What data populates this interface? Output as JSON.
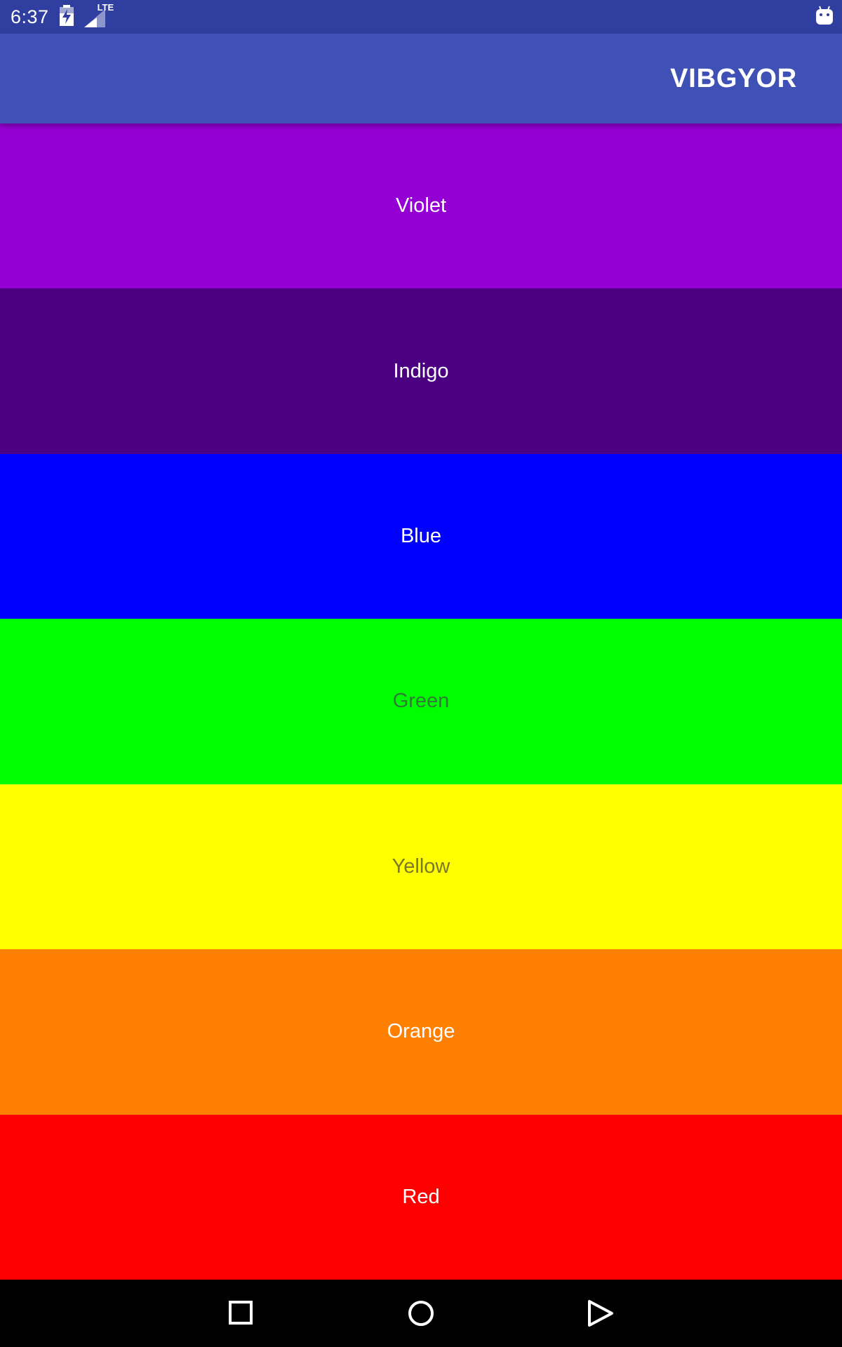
{
  "status_bar": {
    "time": "6:37",
    "icons": [
      "battery-charging-icon",
      "signal-lte-icon",
      "android-debug-icon"
    ],
    "network_label": "LTE"
  },
  "app_bar": {
    "action_label": "VIBGYOR",
    "color": "#3F51B5"
  },
  "colors": [
    {
      "label": "Violet",
      "background": "#9400D3",
      "text_color": "#FFFFFF"
    },
    {
      "label": "Indigo",
      "background": "#4B0082",
      "text_color": "#FFFFFF"
    },
    {
      "label": "Blue",
      "background": "#0000FF",
      "text_color": "#FFFFFF"
    },
    {
      "label": "Green",
      "background": "#00FF00",
      "text_color": "#2E7D32"
    },
    {
      "label": "Yellow",
      "background": "#FFFF00",
      "text_color": "#7A7A2A"
    },
    {
      "label": "Orange",
      "background": "#FF7F00",
      "text_color": "#FFFFFF"
    },
    {
      "label": "Red",
      "background": "#FF0000",
      "text_color": "#FFFFFF"
    }
  ],
  "nav_bar": {
    "buttons": [
      "recents-square-icon",
      "home-circle-icon",
      "back-triangle-icon"
    ]
  }
}
